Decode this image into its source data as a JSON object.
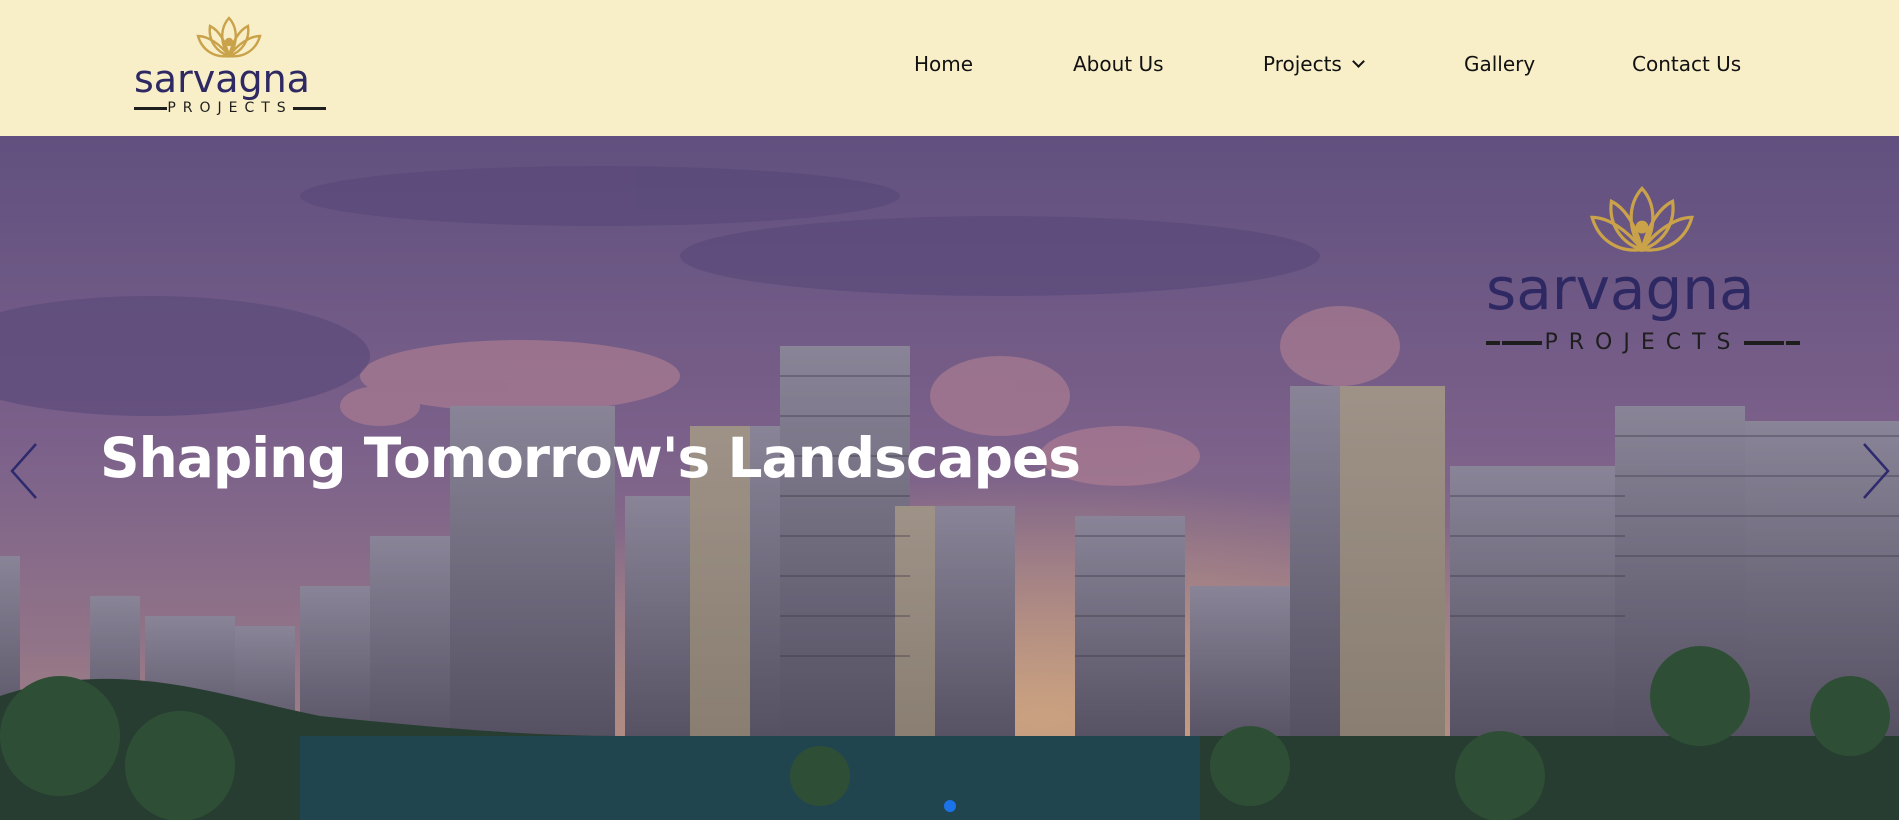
{
  "brand": {
    "name": "sarvagna",
    "tagline": "PROJECTS"
  },
  "nav": {
    "items": [
      {
        "label": "Home"
      },
      {
        "label": "About Us"
      },
      {
        "label": "Projects"
      },
      {
        "label": "Gallery"
      },
      {
        "label": "Contact Us"
      }
    ]
  },
  "hero": {
    "title": "Shaping Tomorrow's Landscapes",
    "slides_total": 1,
    "active_slide": 1
  },
  "colors": {
    "header_bg": "#f8efc9",
    "brand_navy": "#2e2963",
    "brand_gold": "#c9a24a",
    "active_dot": "#1a73e8"
  },
  "icons": {
    "dropdown": "chevron-down-icon",
    "prev": "chevron-left-icon",
    "next": "chevron-right-icon"
  }
}
